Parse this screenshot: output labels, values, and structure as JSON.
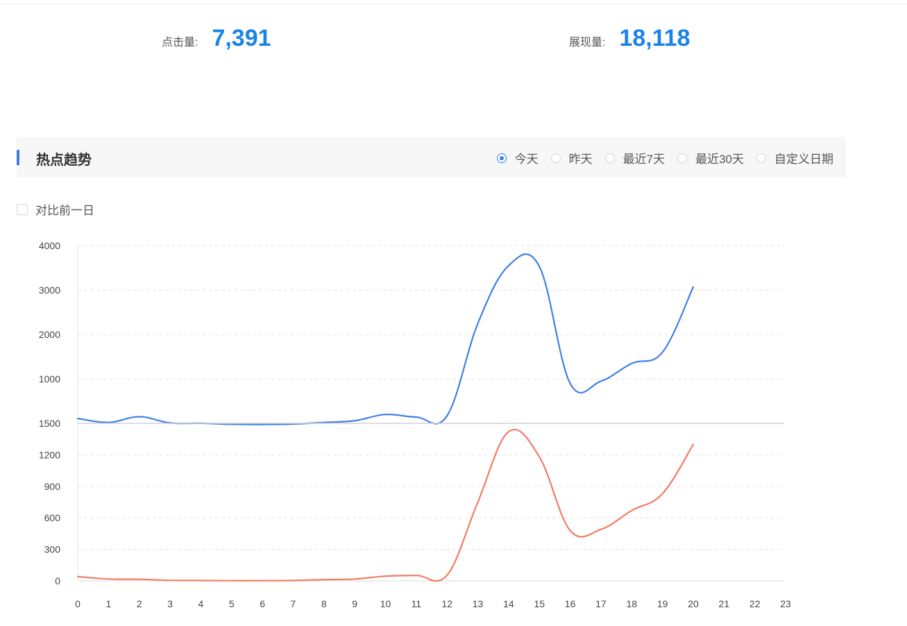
{
  "stats": {
    "clicks": {
      "label": "点击量:",
      "value": "7,391"
    },
    "views": {
      "label": "展现量:",
      "value": "18,118"
    }
  },
  "section": {
    "title": "热点趋势"
  },
  "date_range": {
    "options": [
      "今天",
      "昨天",
      "最近7天",
      "最近30天",
      "自定义日期"
    ],
    "selected": "今天"
  },
  "compare_option": {
    "label": "对比前一日",
    "checked": false
  },
  "colors": {
    "accent": "#3b7ce8",
    "stat_value": "#1a83e8",
    "clicks_series": "#f47b63",
    "views_series": "#3f7fe6"
  },
  "chart_data": [
    {
      "type": "line",
      "title": "",
      "x": [
        0,
        1,
        2,
        3,
        4,
        5,
        6,
        7,
        8,
        9,
        10,
        11,
        12,
        13,
        14,
        15,
        16,
        17,
        18,
        19,
        20
      ],
      "x_ticks": [
        "0",
        "1",
        "2",
        "3",
        "4",
        "5",
        "6",
        "7",
        "8",
        "9",
        "10",
        "11",
        "12",
        "13",
        "14",
        "15",
        "16",
        "17",
        "18",
        "19",
        "20",
        "21",
        "22",
        "23"
      ],
      "series": [
        {
          "values": [
            110,
            20,
            150,
            10,
            2,
            -20,
            -25,
            -15,
            20,
            60,
            200,
            140,
            170,
            2250,
            3550,
            3530,
            900,
            950,
            1350,
            1600,
            3070
          ]
        }
      ],
      "ylim": [
        0,
        4000
      ],
      "y_ticks": [
        1000,
        2000,
        3000,
        4000
      ],
      "grid": true
    },
    {
      "type": "line",
      "title": "",
      "x": [
        0,
        1,
        2,
        3,
        4,
        5,
        6,
        7,
        8,
        9,
        10,
        11,
        12,
        13,
        14,
        15,
        16,
        17,
        18,
        19,
        20
      ],
      "x_ticks": [
        "0",
        "1",
        "2",
        "3",
        "4",
        "5",
        "6",
        "7",
        "8",
        "9",
        "10",
        "11",
        "12",
        "13",
        "14",
        "15",
        "16",
        "17",
        "18",
        "19",
        "20",
        "21",
        "22",
        "23"
      ],
      "series": [
        {
          "values": [
            40,
            18,
            15,
            5,
            4,
            2,
            2,
            4,
            12,
            18,
            45,
            52,
            55,
            750,
            1420,
            1180,
            480,
            490,
            670,
            830,
            1300
          ]
        }
      ],
      "ylim": [
        0,
        1500
      ],
      "y_ticks": [
        0,
        300,
        600,
        900,
        1200,
        1500
      ],
      "grid": true
    }
  ]
}
